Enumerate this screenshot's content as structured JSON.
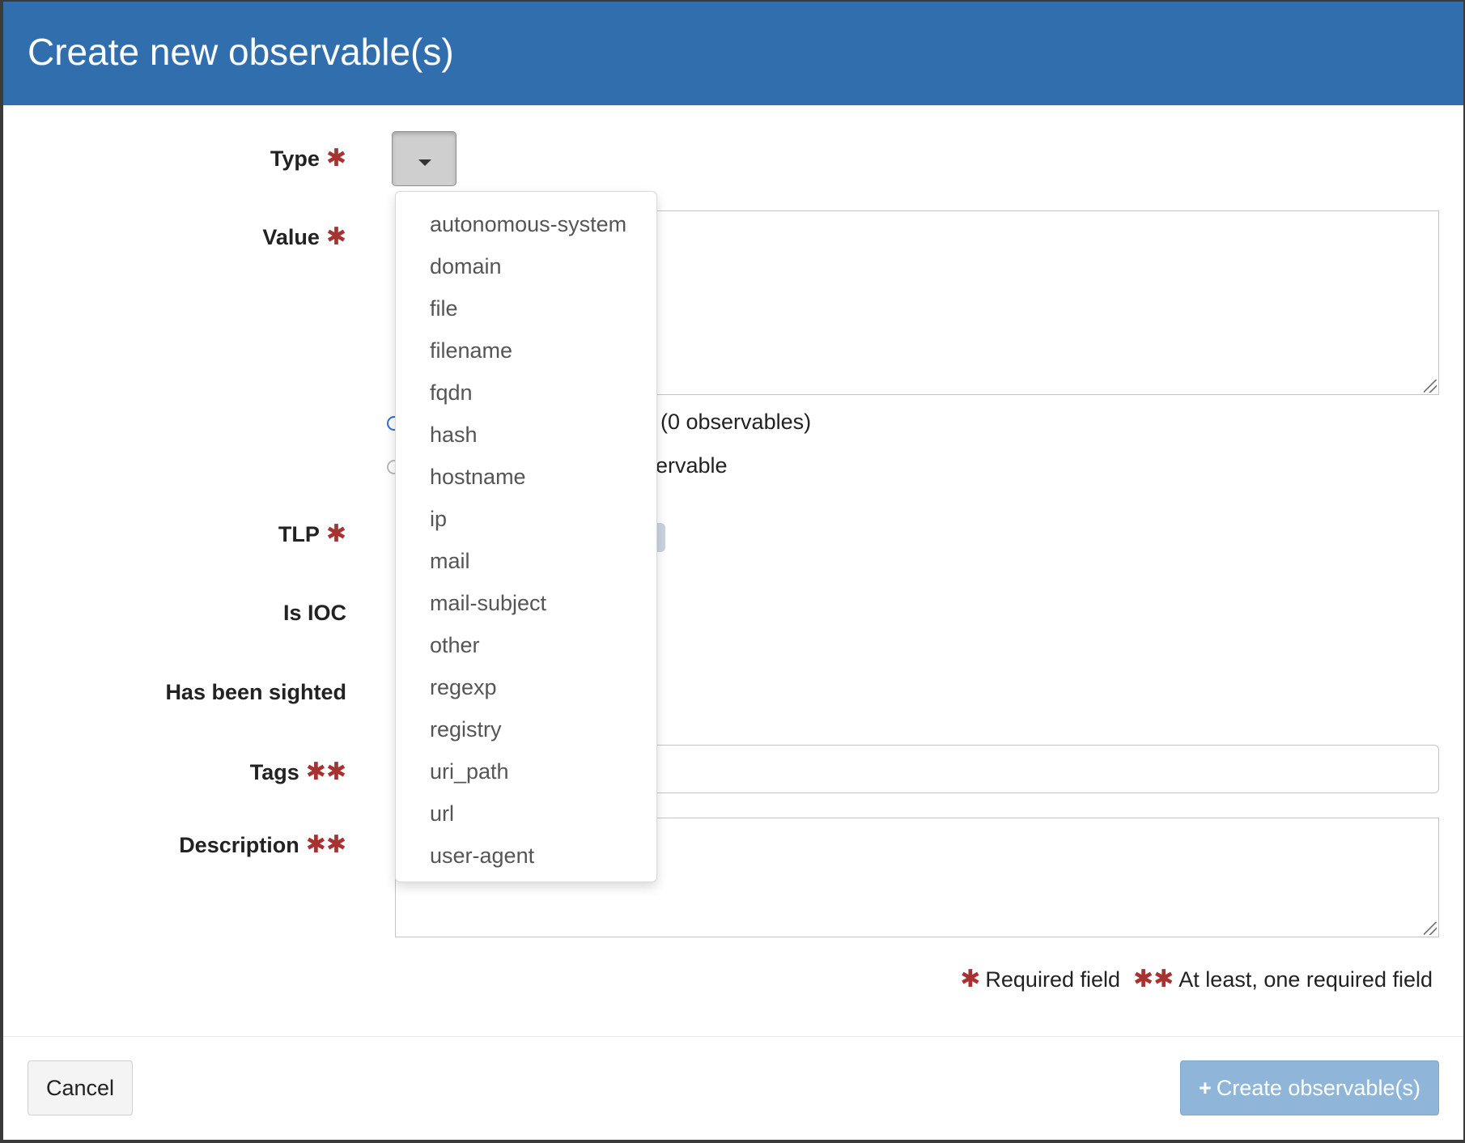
{
  "modal": {
    "title": "Create new observable(s)"
  },
  "form": {
    "labels": {
      "type": "Type",
      "value": "Value",
      "tlp": "TLP",
      "is_ioc": "Is IOC",
      "has_been_sighted": "Has been sighted",
      "tags": "Tags",
      "description": "Description"
    },
    "required_marker": "✱",
    "double_required_marker": "✱✱",
    "value_options": {
      "one_per_line_visible": "(0 observables)",
      "single_visible": "ervable"
    }
  },
  "type_dropdown": {
    "options": [
      "autonomous-system",
      "domain",
      "file",
      "filename",
      "fqdn",
      "hash",
      "hostname",
      "ip",
      "mail",
      "mail-subject",
      "other",
      "regexp",
      "registry",
      "uri_path",
      "url",
      "user-agent"
    ]
  },
  "legend": {
    "required": "Required field",
    "at_least_one": "At least, one required field"
  },
  "footer": {
    "cancel_label": "Cancel",
    "create_label": "Create observable(s)"
  }
}
